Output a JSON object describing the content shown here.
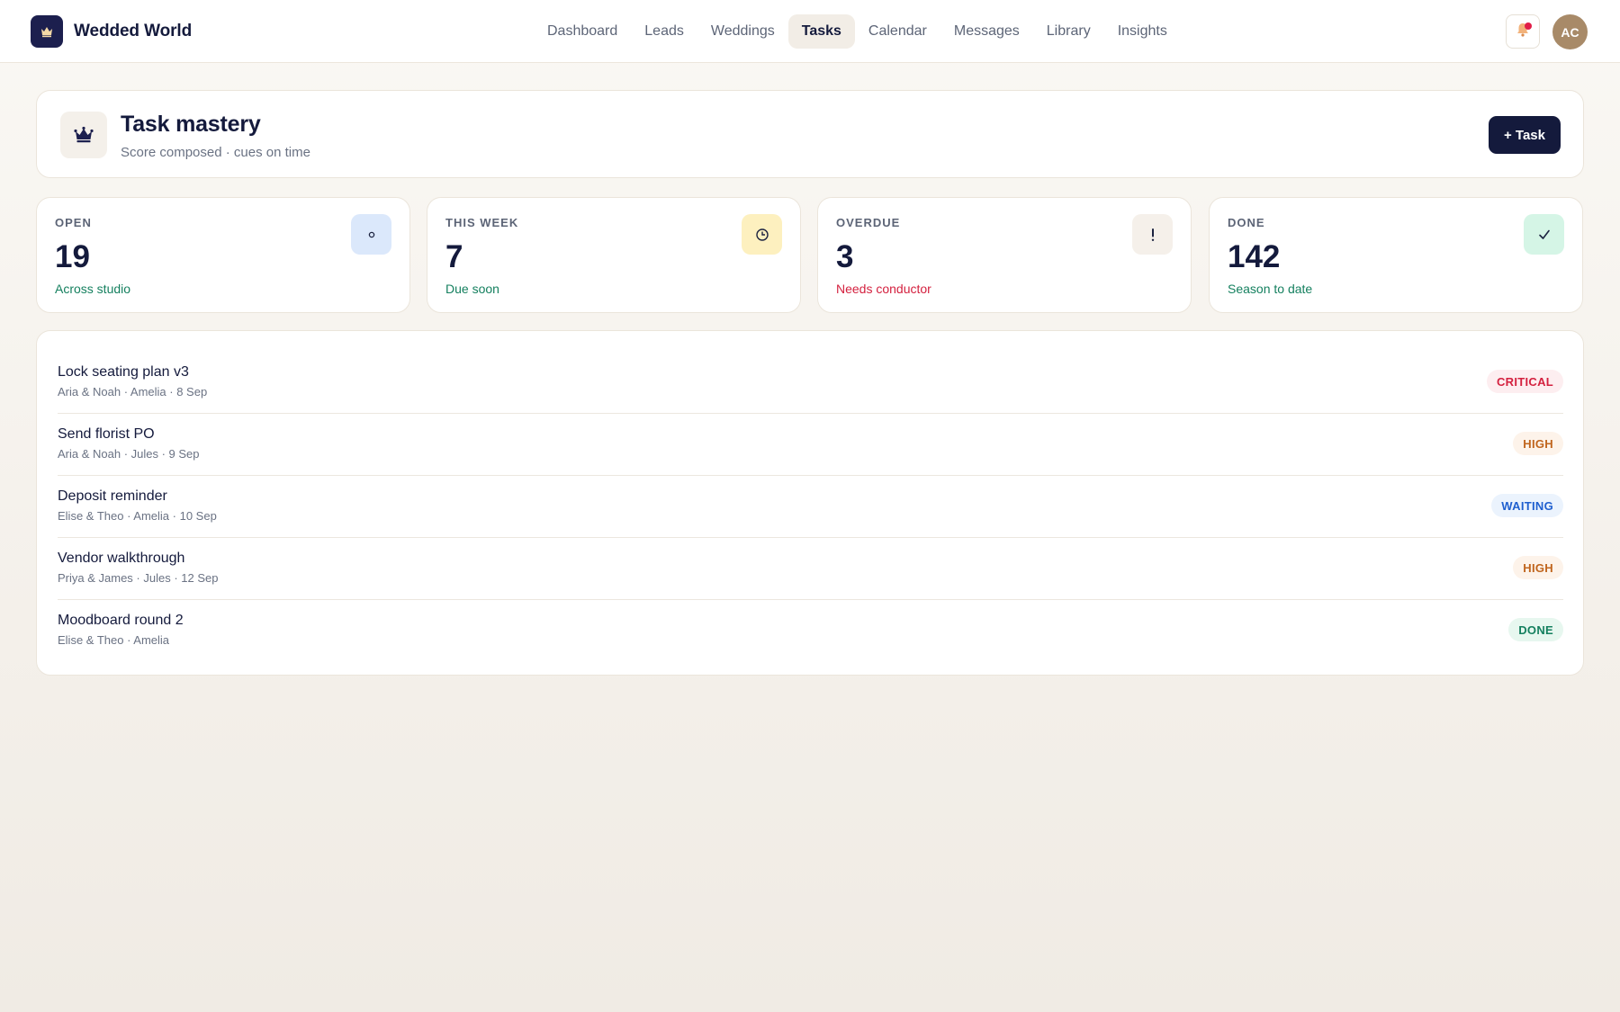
{
  "app": {
    "name": "Wedded World",
    "logo_icon": "crown-icon",
    "brand_color": "#1c1f4e"
  },
  "nav": {
    "items": [
      {
        "label": "Dashboard",
        "active": false
      },
      {
        "label": "Leads",
        "active": false
      },
      {
        "label": "Weddings",
        "active": false
      },
      {
        "label": "Tasks",
        "active": true
      },
      {
        "label": "Calendar",
        "active": false
      },
      {
        "label": "Messages",
        "active": false
      },
      {
        "label": "Library",
        "active": false
      },
      {
        "label": "Insights",
        "active": false
      }
    ]
  },
  "user": {
    "initials": "AC",
    "notifications_unread": true
  },
  "header": {
    "icon": "crown-icon",
    "title": "Task mastery",
    "subtitle": "Score composed · cues on time",
    "add_button_label": "+ Task"
  },
  "stats": [
    {
      "label": "OPEN",
      "value": "19",
      "note": "Across studio",
      "note_color": "#15805f",
      "icon": "circle-icon",
      "icon_bg": "#dbe8fb"
    },
    {
      "label": "THIS WEEK",
      "value": "7",
      "note": "Due soon",
      "note_color": "#15805f",
      "icon": "clock-icon",
      "icon_bg": "#fdf0bf"
    },
    {
      "label": "OVERDUE",
      "value": "3",
      "note": "Needs conductor",
      "note_color": "#d4213f",
      "icon": "exclamation-icon",
      "icon_bg": "#f5f0ea"
    },
    {
      "label": "DONE",
      "value": "142",
      "note": "Season to date",
      "note_color": "#15805f",
      "icon": "check-icon",
      "icon_bg": "#d5f5e6"
    }
  ],
  "tasks": [
    {
      "title": "Lock seating plan v3",
      "meta": "Aria & Noah · Amelia · 8 Sep",
      "status": "CRITICAL",
      "status_color": "#d4213f",
      "status_bg": "#fdeef0"
    },
    {
      "title": "Send florist PO",
      "meta": "Aria & Noah · Jules · 9 Sep",
      "status": "HIGH",
      "status_color": "#c0651d",
      "status_bg": "#fdf3ea"
    },
    {
      "title": "Deposit reminder",
      "meta": "Elise & Theo · Amelia · 10 Sep",
      "status": "WAITING",
      "status_color": "#1f5fcf",
      "status_bg": "#ebf3fd"
    },
    {
      "title": "Vendor walkthrough",
      "meta": "Priya & James · Jules · 12 Sep",
      "status": "HIGH",
      "status_color": "#c0651d",
      "status_bg": "#fdf3ea"
    },
    {
      "title": "Moodboard round 2",
      "meta": "Elise & Theo · Amelia",
      "status": "DONE",
      "status_color": "#15805f",
      "status_bg": "#e7f7ef"
    }
  ]
}
